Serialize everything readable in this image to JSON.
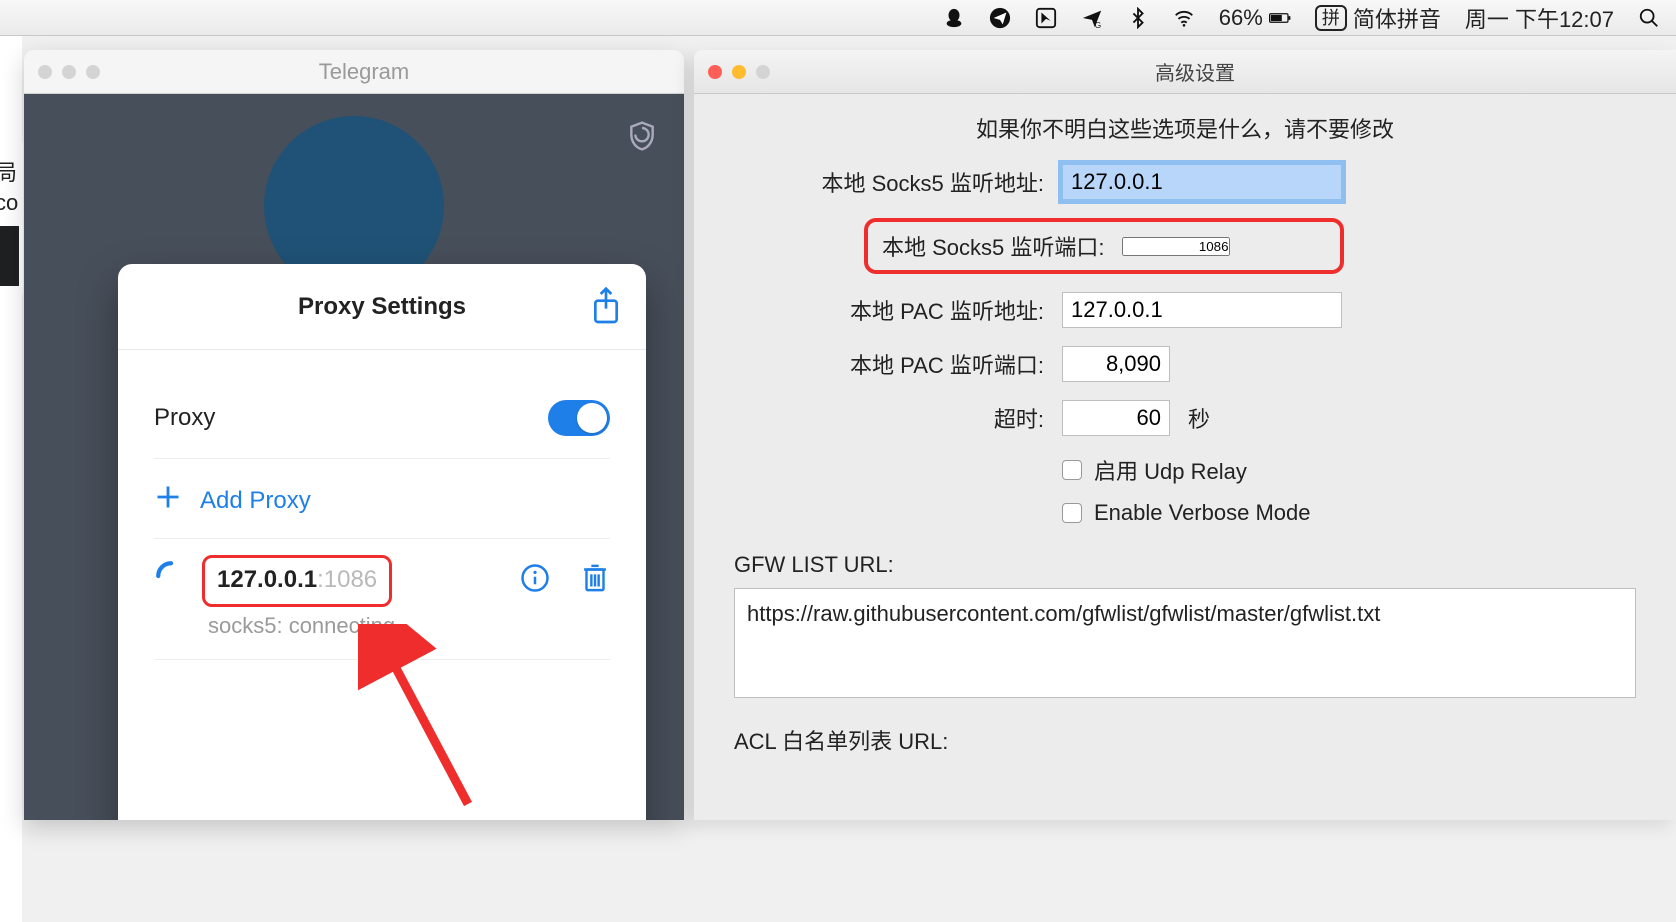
{
  "menubar": {
    "battery_pct": "66%",
    "ime_box": "拼",
    "ime_name": "简体拼音",
    "datetime": "周一 下午12:07"
  },
  "telegram": {
    "window_title": "Telegram",
    "left_slice_line1": "局",
    "left_slice_line2": "co",
    "sheet_title": "Proxy Settings",
    "proxy_label": "Proxy",
    "add_proxy_label": "Add Proxy",
    "proxy_entry": {
      "ip": "127.0.0.1",
      "port": ":1086"
    },
    "proxy_status": "socks5: connecting"
  },
  "advanced": {
    "window_title": "高级设置",
    "note": "如果你不明白这些选项是什么，请不要修改",
    "fields": {
      "socks5_addr_label": "本地 Socks5 监听地址:",
      "socks5_addr_value": "127.0.0.1",
      "socks5_port_label": "本地 Socks5 监听端口:",
      "socks5_port_value": "1086",
      "pac_addr_label": "本地 PAC 监听地址:",
      "pac_addr_value": "127.0.0.1",
      "pac_port_label": "本地 PAC 监听端口:",
      "pac_port_value": "8,090",
      "timeout_label": "超时:",
      "timeout_value": "60",
      "timeout_unit": "秒",
      "udp_relay_label": "启用 Udp Relay",
      "verbose_label": "Enable Verbose Mode"
    },
    "gfw_label": "GFW LIST URL:",
    "gfw_url": "https://raw.githubusercontent.com/gfwlist/gfwlist/master/gfwlist.txt",
    "acl_label": "ACL 白名单列表 URL:"
  }
}
